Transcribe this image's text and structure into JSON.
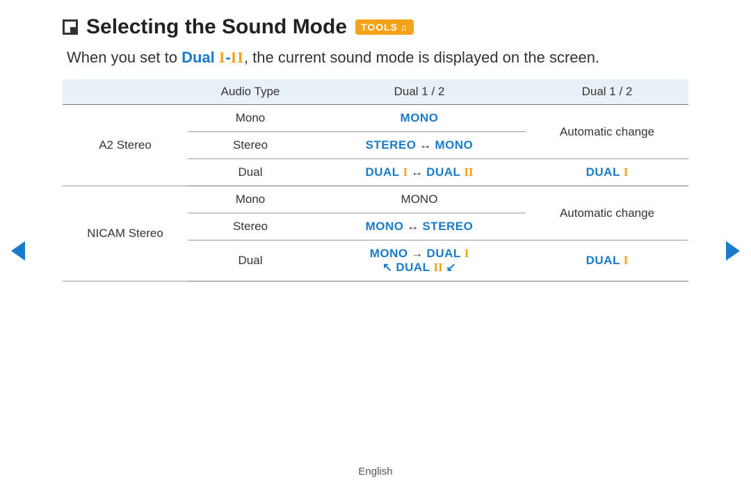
{
  "header": {
    "title": "Selecting the Sound Mode",
    "badge": "TOOLS"
  },
  "intro": {
    "pre": "When you set to ",
    "dual_word": "Dual ",
    "roman1": "I",
    "dash": "-",
    "roman2": "II",
    "post": ", the current sound mode is displayed on the screen."
  },
  "table": {
    "headers": {
      "c1": "",
      "c2": "Audio Type",
      "c3": "Dual 1 / 2",
      "c4": "Dual 1 / 2"
    },
    "group1": {
      "label": "A2 Stereo",
      "r1": {
        "type": "Mono",
        "d1": "MONO",
        "d2_merge": "Automatic change"
      },
      "r2": {
        "type": "Stereo",
        "d1_a": "STEREO",
        "arr": "↔",
        "d1_b": "MONO"
      },
      "r3": {
        "type": "Dual",
        "d1_a": "DUAL ",
        "ra": "I",
        "arr": "↔",
        "d1_b": "DUAL ",
        "rb": "II",
        "d2": "DUAL ",
        "d2r": "I"
      }
    },
    "group2": {
      "label": "NICAM Stereo",
      "r1": {
        "type": "Mono",
        "d1": "MONO",
        "d2_merge": "Automatic change"
      },
      "r2": {
        "type": "Stereo",
        "d1_a": "MONO",
        "arr": "↔",
        "d1_b": "STEREO"
      },
      "r3": {
        "type": "Dual",
        "line1_a": "MONO",
        "line1_arr": "→",
        "line1_b": "DUAL ",
        "line1_r": "I",
        "line2_al": "↖",
        "line2_b": "DUAL ",
        "line2_r": "II",
        "line2_ar": "↙",
        "d2": "DUAL ",
        "d2r": "I"
      }
    }
  },
  "footer": {
    "lang": "English"
  }
}
